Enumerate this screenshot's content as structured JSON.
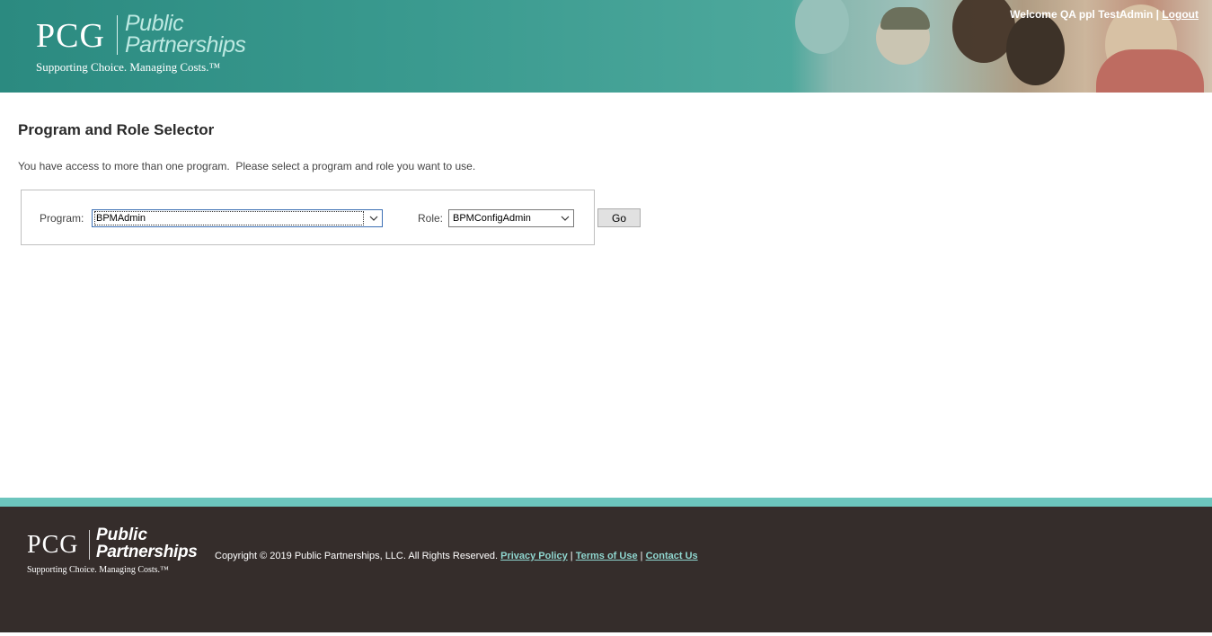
{
  "header": {
    "logo": {
      "pcg": "PCG",
      "public": "Public",
      "partnerships": "Partnerships",
      "tagline": "Supporting Choice.  Managing Costs.™"
    },
    "welcome_text": "Welcome QA ppl TestAdmin |",
    "logout_label": "Logout"
  },
  "main": {
    "title": "Program and Role Selector",
    "intro": "You have access to more than one program.  Please select a program and role you want to use.",
    "program_label": "Program:",
    "program_value": "BPMAdmin",
    "role_label": "Role:",
    "role_value": "BPMConfigAdmin",
    "go_label": "Go"
  },
  "footer": {
    "logo": {
      "pcg": "PCG",
      "public": "Public",
      "partnerships": "Partnerships",
      "tagline": "Supporting Choice.  Managing Costs.™"
    },
    "copyright": "Copyright © 2019 Public Partnerships, LLC. All Rights Reserved.",
    "links": {
      "privacy": "Privacy Policy",
      "terms": "Terms of Use",
      "contact": "Contact Us"
    },
    "separator": "|"
  },
  "colors": {
    "header_teal": "#3a9a8f",
    "footer_bg": "#352d2b",
    "footer_stripe": "#6cc5bd",
    "link_teal": "#8fd6cf"
  },
  "icons": {
    "dropdown": "chevron-down-icon",
    "header_image": "people-photo-banner"
  }
}
